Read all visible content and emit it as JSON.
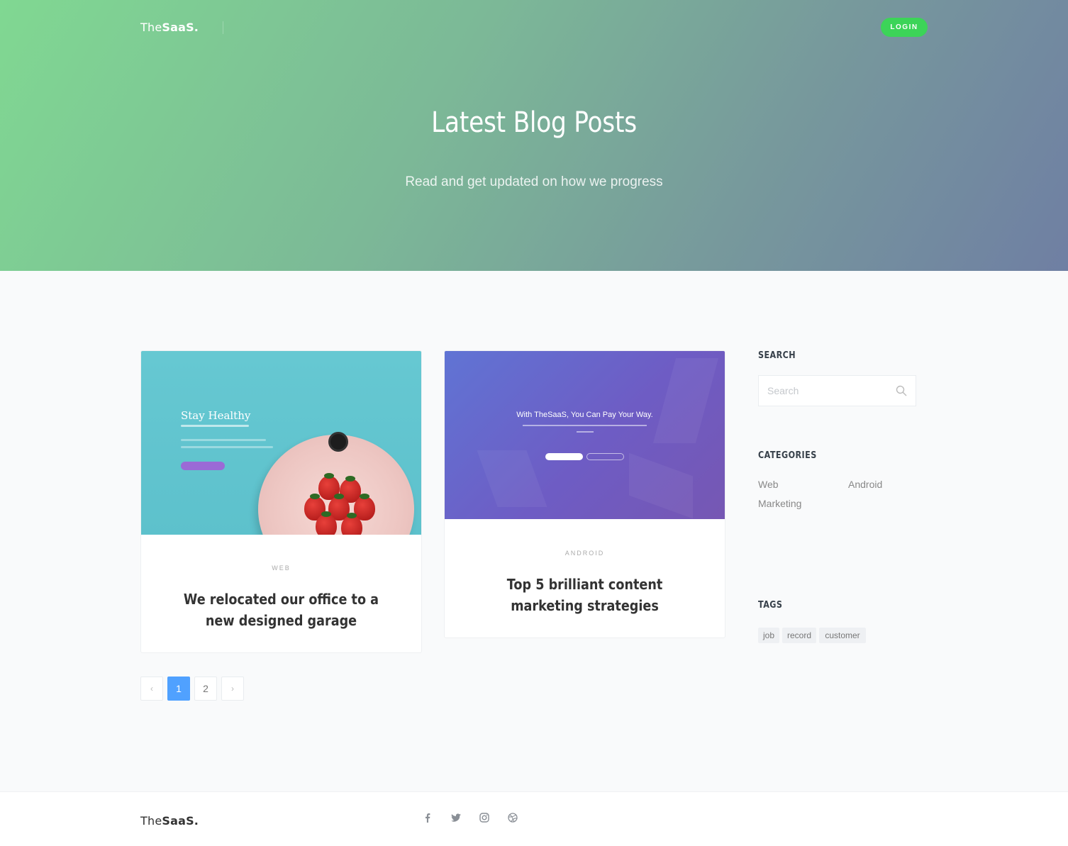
{
  "brand": {
    "thin": "The",
    "bold": "SaaS."
  },
  "nav": {
    "login_label": "LOGIN"
  },
  "hero": {
    "title": "Latest Blog Posts",
    "subtitle": "Read and get updated on how we progress"
  },
  "posts": [
    {
      "category": "WEB",
      "title": "We relocated our office to a new designed garage",
      "image": {
        "title": "Stay Healthy"
      }
    },
    {
      "category": "ANDROID",
      "title": "Top 5 brilliant content marketing strategies",
      "image": {
        "title": "With TheSaaS, You Can Pay Your Way."
      }
    }
  ],
  "pagination": {
    "prev": "‹",
    "pages": [
      "1",
      "2"
    ],
    "active": "1",
    "next": "›"
  },
  "sidebar": {
    "search": {
      "heading": "SEARCH",
      "placeholder": "Search"
    },
    "categories": {
      "heading": "CATEGORIES",
      "items": [
        "Web",
        "Android",
        "Marketing"
      ]
    },
    "tags": {
      "heading": "TAGS",
      "items": [
        "job",
        "record",
        "customer"
      ]
    }
  },
  "footer": {
    "social_icons": [
      "facebook-icon",
      "twitter-icon",
      "instagram-icon",
      "dribbble-icon"
    ]
  },
  "colors": {
    "accent_green": "#3cd458",
    "pager_active": "#50a1ff"
  }
}
